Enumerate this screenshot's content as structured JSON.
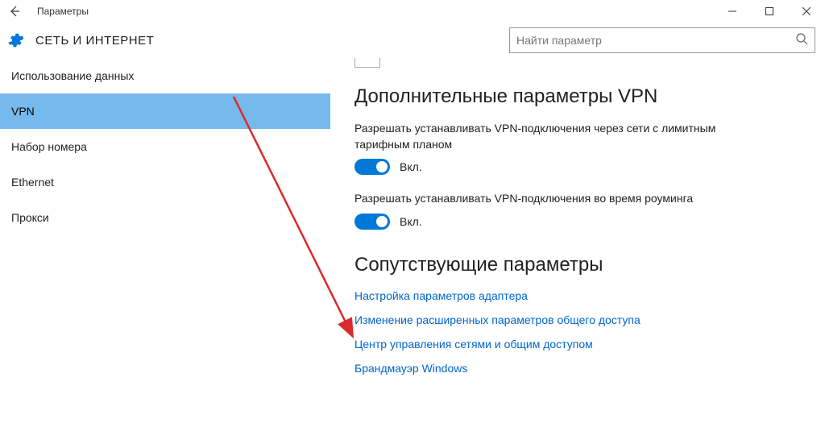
{
  "titlebar": {
    "title": "Параметры"
  },
  "header": {
    "title": "СЕТЬ И ИНТЕРНЕТ",
    "search_placeholder": "Найти параметр"
  },
  "sidebar": {
    "items": [
      {
        "label": "Использование данных",
        "selected": false
      },
      {
        "label": "VPN",
        "selected": true
      },
      {
        "label": "Набор номера",
        "selected": false
      },
      {
        "label": "Ethernet",
        "selected": false
      },
      {
        "label": "Прокси",
        "selected": false
      }
    ]
  },
  "main": {
    "section1_title": "Дополнительные параметры VPN",
    "setting1_desc": "Разрешать устанавливать VPN-подключения через сети с лимитным тарифным планом",
    "setting1_state": "Вкл.",
    "setting2_desc": "Разрешать устанавливать VPN-подключения во время роуминга",
    "setting2_state": "Вкл.",
    "section2_title": "Сопутствующие параметры",
    "links": [
      "Настройка параметров адаптера",
      "Изменение расширенных параметров общего доступа",
      "Центр управления сетями и общим доступом",
      "Брандмауэр Windows"
    ]
  }
}
